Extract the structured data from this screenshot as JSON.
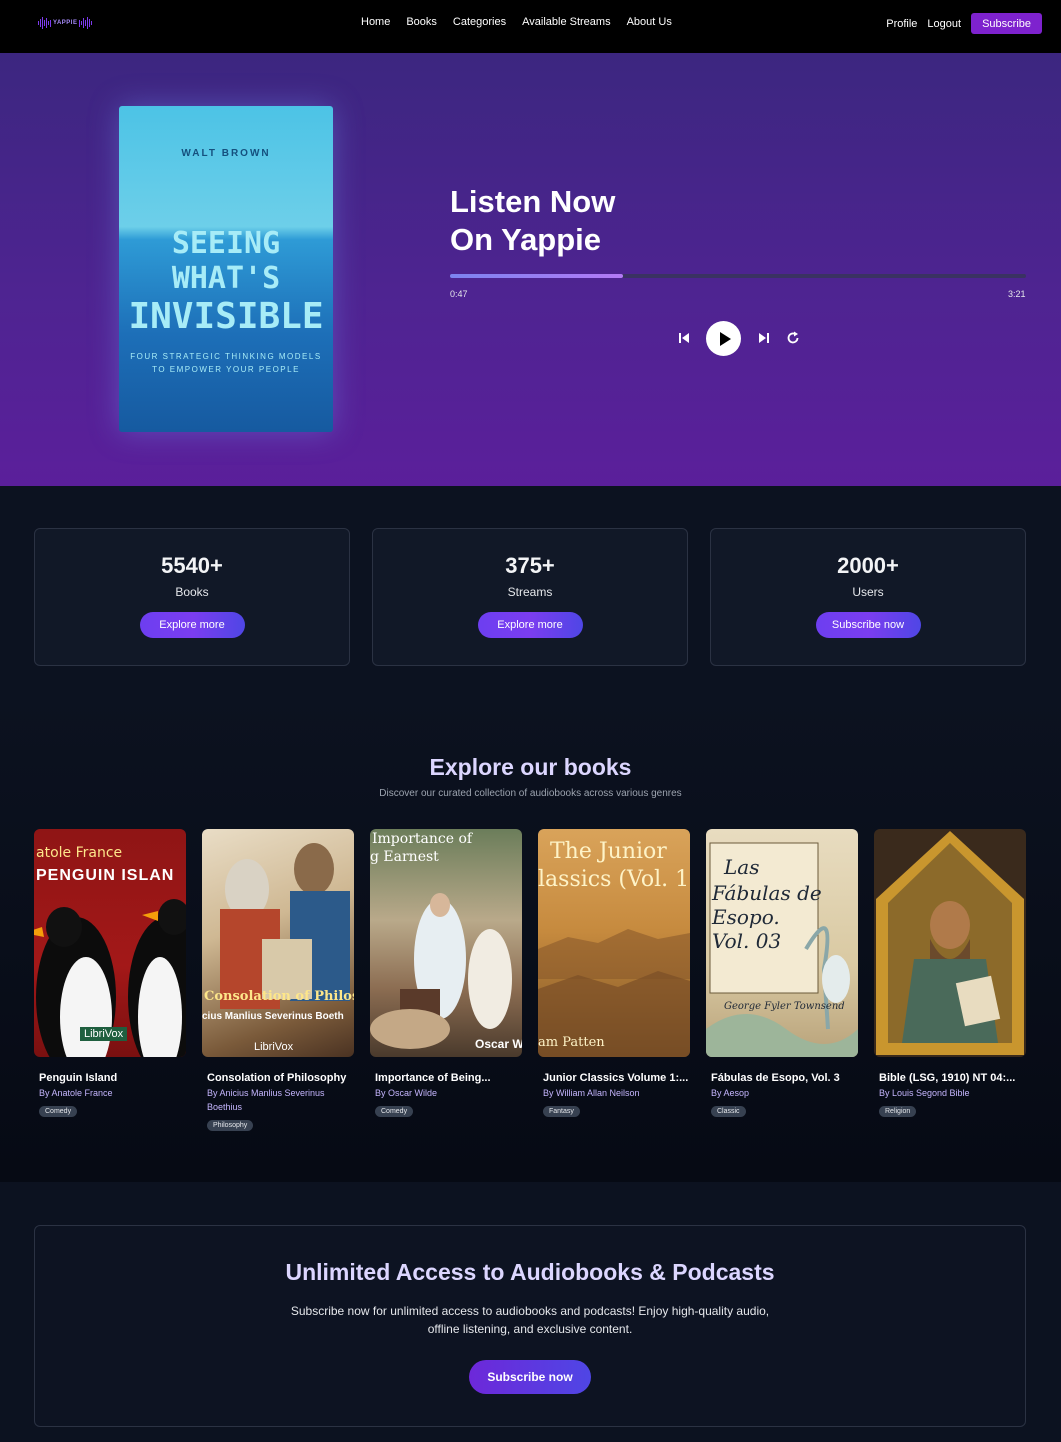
{
  "nav": {
    "logo_text": "YAPPIE",
    "links": [
      "Home",
      "Books",
      "Categories",
      "Available Streams",
      "About Us"
    ],
    "profile": "Profile",
    "logout": "Logout",
    "subscribe": "Subscribe"
  },
  "hero": {
    "cover": {
      "author": "WALT BROWN",
      "title_line1": "SEEING",
      "title_line2": "WHAT'S",
      "title_line3": "INVISIBLE",
      "subtitle_line1": "FOUR STRATEGIC THINKING MODELS",
      "subtitle_line2": "TO EMPOWER YOUR PEOPLE"
    },
    "title_line1": "Listen Now",
    "title_line2": "On Yappie",
    "current_time": "0:47",
    "duration": "3:21",
    "progress": 0.3,
    "icons": [
      "skip-back-icon",
      "play-icon",
      "skip-forward-icon",
      "replay-icon"
    ]
  },
  "stats": [
    {
      "number": "5540+",
      "label": "Books",
      "button": "Explore more"
    },
    {
      "number": "375+",
      "label": "Streams",
      "button": "Explore more"
    },
    {
      "number": "2000+",
      "label": "Users",
      "button": "Subscribe now"
    }
  ],
  "explore": {
    "title": "Explore our books",
    "subtitle": "Discover our curated collection of audiobooks across various genres",
    "books": [
      {
        "title": "Penguin Island",
        "author": "By Anatole France",
        "genre": "Comedy",
        "cover_text1": "atole France",
        "cover_text2": "PENGUIN ISLAN",
        "cover_badge": "LibriVox"
      },
      {
        "title": "Consolation of Philosophy",
        "author": "By Anicius Manlius Severinus Boethius",
        "genre": "Philosophy",
        "cover_text1": "Consolation of Philoso",
        "cover_text2": "cius Manlius Severinus Boeth",
        "cover_badge": "LibriVox"
      },
      {
        "title": "Importance of Being...",
        "author": "By Oscar Wilde",
        "genre": "Comedy",
        "cover_text1": "Importance of",
        "cover_text2": "g Earnest",
        "cover_badge": "Oscar W"
      },
      {
        "title": "Junior Classics Volume 1:...",
        "author": "By William Allan Neilson",
        "genre": "Fantasy",
        "cover_text1": "The Junior",
        "cover_text2": "lassics (Vol. 1",
        "cover_badge": "am Patten"
      },
      {
        "title": "Fábulas de Esopo, Vol. 3",
        "author": "By Aesop",
        "genre": "Classic",
        "cover_text1": "Las",
        "cover_text2": "Fábulas de",
        "cover_text3": "Esopo.",
        "cover_text4": "Vol. 03",
        "cover_badge": "George Fyler Townsend"
      },
      {
        "title": "Bible (LSG, 1910) NT 04:...",
        "author": "By Louis Segond Bible",
        "genre": "Religion"
      }
    ]
  },
  "cta": {
    "title": "Unlimited Access to Audiobooks & Podcasts",
    "text": "Subscribe now for unlimited access to audiobooks and podcasts! Enjoy high-quality audio, offline listening, and exclusive content.",
    "button": "Subscribe now"
  },
  "colors": {
    "accent": "#7e22ce",
    "hero_top": "#3c2680",
    "hero_bottom": "#5b1f9b",
    "tag_bg": "#374151"
  }
}
